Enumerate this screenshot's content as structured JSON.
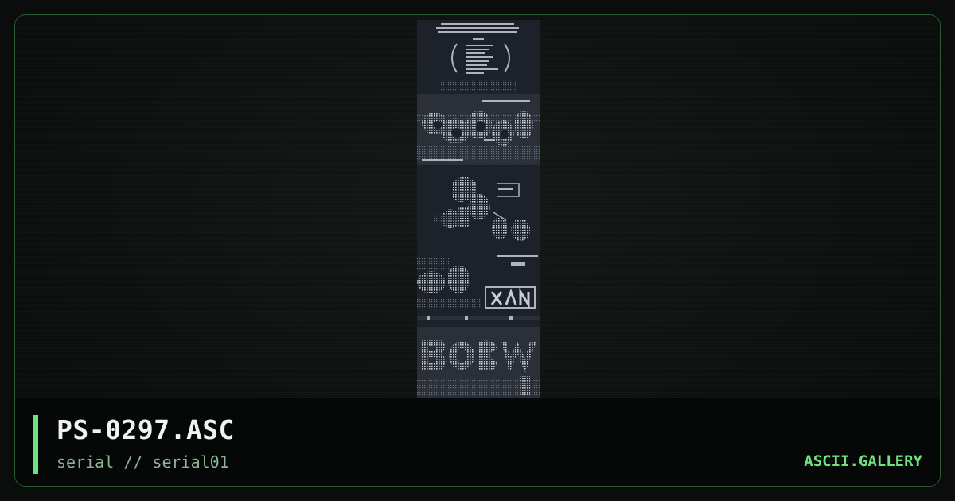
{
  "artwork": {
    "title": "PS-0297.ASC",
    "subtitle": "serial // serial01"
  },
  "brand": {
    "name": "ASCII.GALLERY"
  },
  "colors": {
    "accent": "#6ee27e",
    "border": "#2a5a33",
    "background": "#0b0d0c",
    "preview_background": "#1d212a",
    "subtitle": "#8fb598"
  }
}
